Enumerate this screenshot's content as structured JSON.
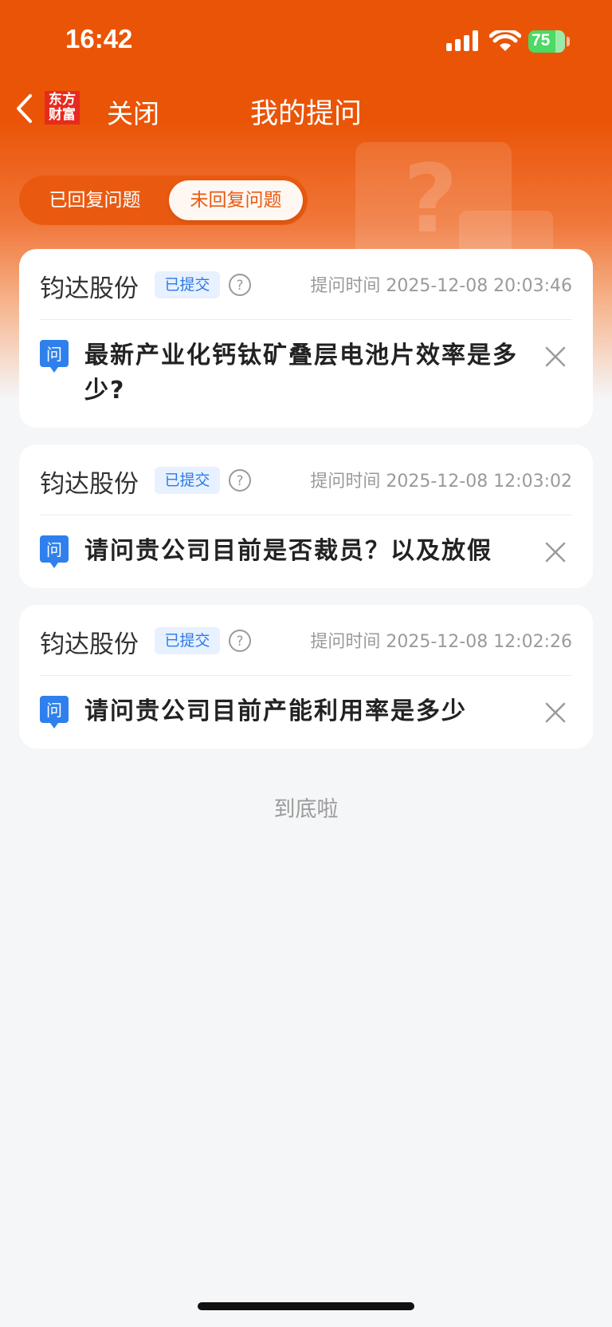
{
  "status_bar": {
    "time": "16:42",
    "battery": "75"
  },
  "nav": {
    "logo_line1": "东方",
    "logo_line2": "财富",
    "close_label": "关闭",
    "title": "我的提问"
  },
  "tabs": [
    {
      "label": "已回复问题",
      "active": false
    },
    {
      "label": "未回复问题",
      "active": true
    }
  ],
  "questions": [
    {
      "company": "钧达股份",
      "status": "已提交",
      "time": "提问时间 2025-12-08 20:03:46",
      "icon_label": "问",
      "text": "最新产业化钙钛矿叠层电池片效率是多少?"
    },
    {
      "company": "钧达股份",
      "status": "已提交",
      "time": "提问时间 2025-12-08 12:03:02",
      "icon_label": "问",
      "text": "请问贵公司目前是否裁员？以及放假"
    },
    {
      "company": "钧达股份",
      "status": "已提交",
      "time": "提问时间 2025-12-08 12:02:26",
      "icon_label": "问",
      "text": "请问贵公司目前产能利用率是多少"
    }
  ],
  "footer": {
    "end_text": "到底啦"
  },
  "colors": {
    "brand": "#ea5406",
    "badge_text": "#2e79e6",
    "badge_bg": "#e7f1ff",
    "question_icon": "#2f80ed"
  }
}
